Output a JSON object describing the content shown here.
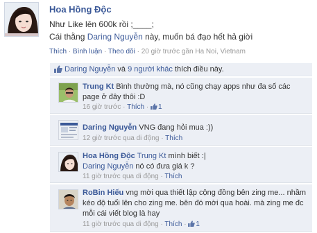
{
  "post": {
    "author": "Hoa Hồng Độc",
    "line1": "Như Like lên 600k rồi ;____;",
    "line2_prefix": "Cái thằng ",
    "line2_name": "Daring Nguyễn",
    "line2_suffix": " này, muốn bá đạo hết hả giời",
    "actions": {
      "like": "Thích",
      "comment": "Bình luận",
      "follow": "Theo dõi",
      "time_location": "20 giờ trước gần Ha Noi, Vietnam",
      "separator": "·"
    }
  },
  "likes_bar": {
    "name": "Daring Nguyễn",
    "conjunction": " và ",
    "others": "9 người khác",
    "suffix": " thích điều này."
  },
  "comments": [
    {
      "author": "Trung Kt",
      "text": " Bình thường mà, nó cũng chạy apps như đa số các page ở đây thôi :D",
      "time": "16 giờ trước",
      "like": "Thích",
      "like_count": "1",
      "show_count": true
    },
    {
      "author": "Daring Nguyễn",
      "text": " VNG đang hỏi mua :))",
      "time": "12 giờ trước qua di động",
      "like": "Thích",
      "like_count": "",
      "show_count": false
    },
    {
      "author": "Hoa Hồng Độc",
      "mention1": "Trung Kt",
      "text1": " mình biết :|",
      "mention2": "Daring Nguyễn",
      "text2": " nó có đưa giá k ?",
      "time": "11 giờ trước qua di động",
      "like": "Thích",
      "like_count": "",
      "show_count": false
    },
    {
      "author": "RoBin Hiếu",
      "text": " vng mời qua thiết lập cộng đồng bên zing me... nhầm kéo độ tuổi lên cho zing me. bên đó mời qua hoài. mà zing me đc mỗi cái viết blog là hay",
      "time": "11 giờ trước qua di động",
      "like": "Thích",
      "like_count": "1",
      "show_count": true
    }
  ],
  "colors": {
    "link": "#3b5998",
    "comment_bg": "#eceff5",
    "meta": "#999999"
  }
}
